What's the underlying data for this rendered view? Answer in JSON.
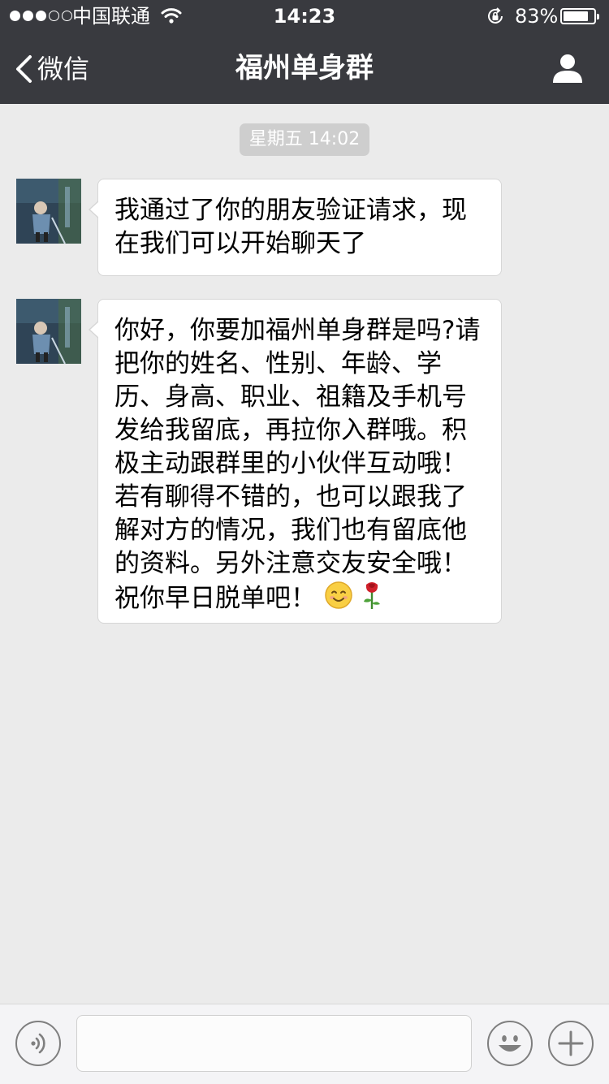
{
  "status_bar": {
    "carrier": "中国联通",
    "time": "14:23",
    "battery_percent": "83%",
    "battery_level": 0.83,
    "signal_bars_filled": 3,
    "signal_bars_total": 5
  },
  "nav": {
    "back_label": "微信",
    "title": "福州单身群",
    "profile_icon": "person-icon"
  },
  "chat": {
    "timestamp": "星期五 14:02",
    "messages": [
      {
        "sender": "other",
        "text": "我通过了你的朋友验证请求，现在我们可以开始聊天了"
      },
      {
        "sender": "other",
        "text": "你好，你要加福州单身群是吗?请把你的姓名、性别、年龄、学历、身高、职业、祖籍及手机号发给我留底，再拉你入群哦。积极主动跟群里的小伙伴互动哦！若有聊得不错的，也可以跟我了解对方的情况，我们也有留底他的资料。另外注意交友安全哦！祝你早日脱单吧！",
        "emojis": [
          "smile-emoji",
          "rose-emoji"
        ]
      }
    ]
  },
  "input_bar": {
    "value": "",
    "voice_icon": "voice-icon",
    "emoji_icon": "emoji-icon",
    "plus_icon": "plus-icon"
  },
  "colors": {
    "nav_background": "#393a3f",
    "chat_background": "#ebebeb",
    "bubble_background": "#ffffff"
  }
}
